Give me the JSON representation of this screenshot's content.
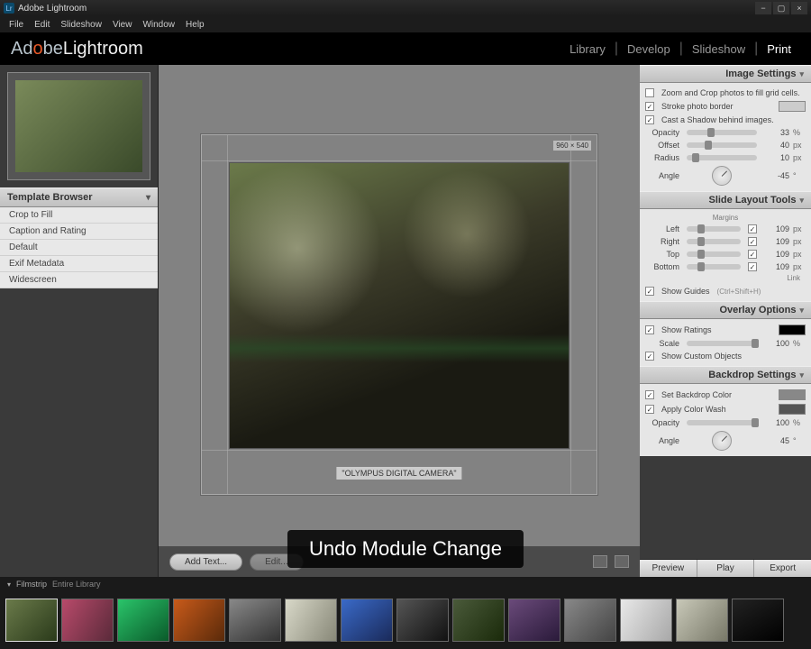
{
  "titlebar": {
    "app_name": "Adobe Lightroom"
  },
  "menubar": {
    "items": [
      "File",
      "Edit",
      "Slideshow",
      "View",
      "Window",
      "Help"
    ]
  },
  "brand": {
    "adobe_pre": "Ad",
    "adobe_red": "o",
    "adobe_post": "be",
    "product": "Lightroom"
  },
  "modules": {
    "items": [
      "Library",
      "Develop",
      "Slideshow",
      "Print"
    ],
    "active_index": 3
  },
  "left": {
    "template_browser_title": "Template Browser",
    "templates": [
      "Crop to Fill",
      "Caption and Rating",
      "Default",
      "Exif Metadata",
      "Widescreen"
    ]
  },
  "center": {
    "slide_size_badge": "960 × 540",
    "caption": "\"OLYMPUS DIGITAL CAMERA\"",
    "add_text_btn": "Add Text...",
    "edit_btn": "Edit..."
  },
  "right": {
    "image_settings": {
      "title": "Image Settings",
      "zoom_crop": "Zoom and Crop photos to fill grid cells.",
      "stroke": "Stroke photo border",
      "shadow": "Cast a Shadow behind images.",
      "opacity": {
        "label": "Opacity",
        "value": "33",
        "unit": "%"
      },
      "offset": {
        "label": "Offset",
        "value": "40",
        "unit": "px"
      },
      "radius": {
        "label": "Radius",
        "value": "10",
        "unit": "px"
      },
      "angle": {
        "label": "Angle",
        "value": "-45",
        "unit": "°"
      }
    },
    "slide_layout": {
      "title": "Slide Layout Tools",
      "margins_label": "Margins",
      "left": {
        "label": "Left",
        "value": "109",
        "unit": "px"
      },
      "right": {
        "label": "Right",
        "value": "109",
        "unit": "px"
      },
      "top": {
        "label": "Top",
        "value": "109",
        "unit": "px"
      },
      "bottom": {
        "label": "Bottom",
        "value": "109",
        "unit": "px"
      },
      "link_label": "Link",
      "show_guides": "Show Guides",
      "show_guides_hint": "(Ctrl+Shift+H)"
    },
    "overlay_options": {
      "title": "Overlay Options",
      "show_ratings": "Show Ratings",
      "scale": {
        "label": "Scale",
        "value": "100",
        "unit": "%"
      },
      "show_custom": "Show Custom Objects"
    },
    "backdrop": {
      "title": "Backdrop Settings",
      "set_color": "Set Backdrop Color",
      "color_wash": "Apply Color Wash",
      "opacity": {
        "label": "Opacity",
        "value": "100",
        "unit": "%"
      },
      "angle": {
        "label": "Angle",
        "value": "45",
        "unit": "°"
      }
    },
    "bottom_buttons": [
      "Preview",
      "Play",
      "Export"
    ]
  },
  "filmstrip": {
    "label": "Filmstrip",
    "scope": "Entire Library",
    "count": 14,
    "selected_index": 0
  },
  "overlay_msg": "Undo Module Change"
}
